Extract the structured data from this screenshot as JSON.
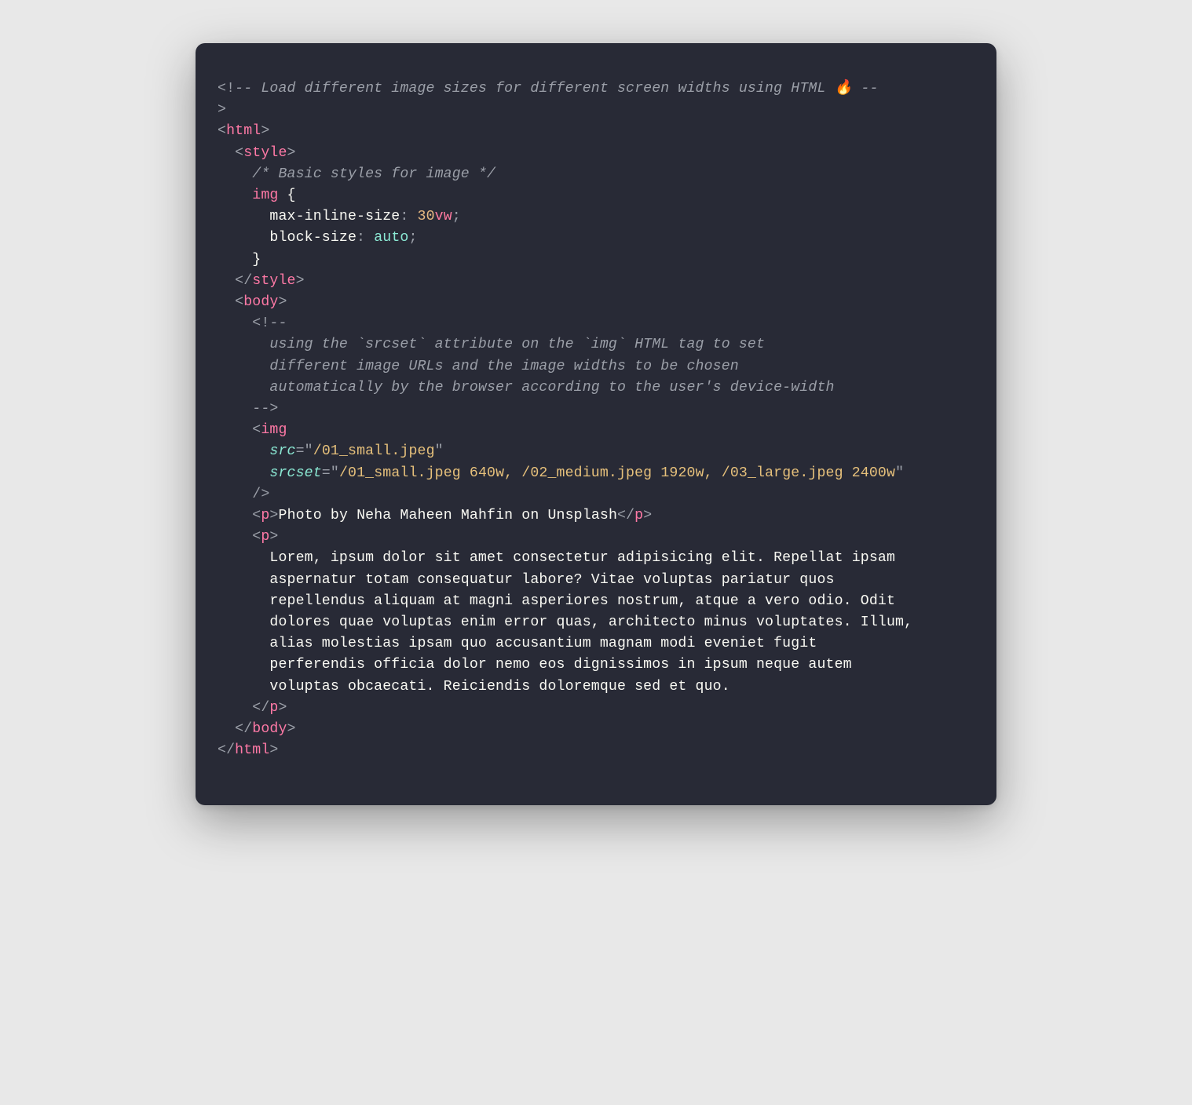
{
  "lines": [
    [
      {
        "cls": "pn",
        "t": "<!"
      },
      {
        "cls": "cm",
        "t": "-- Load different image sizes for different screen widths using HTML 🔥 --"
      }
    ],
    [
      {
        "cls": "pn",
        "t": ">"
      }
    ],
    [
      {
        "cls": "pn",
        "t": "<"
      },
      {
        "cls": "tg",
        "t": "html"
      },
      {
        "cls": "pn",
        "t": ">"
      }
    ],
    [
      {
        "cls": "txt",
        "t": "  "
      },
      {
        "cls": "pn",
        "t": "<"
      },
      {
        "cls": "tg",
        "t": "style"
      },
      {
        "cls": "pn",
        "t": ">"
      }
    ],
    [
      {
        "cls": "cm",
        "t": "    /* Basic styles for image */"
      }
    ],
    [
      {
        "cls": "txt",
        "t": "    "
      },
      {
        "cls": "sel",
        "t": "img"
      },
      {
        "cls": "txt",
        "t": " {"
      }
    ],
    [
      {
        "cls": "txt",
        "t": "      "
      },
      {
        "cls": "prop",
        "t": "max-inline-size"
      },
      {
        "cls": "pn",
        "t": ": "
      },
      {
        "cls": "num",
        "t": "30"
      },
      {
        "cls": "unit",
        "t": "vw"
      },
      {
        "cls": "pn",
        "t": ";"
      }
    ],
    [
      {
        "cls": "txt",
        "t": "      "
      },
      {
        "cls": "prop",
        "t": "block-size"
      },
      {
        "cls": "pn",
        "t": ": "
      },
      {
        "cls": "auto",
        "t": "auto"
      },
      {
        "cls": "pn",
        "t": ";"
      }
    ],
    [
      {
        "cls": "txt",
        "t": "    }"
      }
    ],
    [
      {
        "cls": "txt",
        "t": "  "
      },
      {
        "cls": "pn",
        "t": "</"
      },
      {
        "cls": "tg",
        "t": "style"
      },
      {
        "cls": "pn",
        "t": ">"
      }
    ],
    [
      {
        "cls": "txt",
        "t": "  "
      },
      {
        "cls": "pn",
        "t": "<"
      },
      {
        "cls": "tg",
        "t": "body"
      },
      {
        "cls": "pn",
        "t": ">"
      }
    ],
    [
      {
        "cls": "txt",
        "t": "    "
      },
      {
        "cls": "pn",
        "t": "<!"
      },
      {
        "cls": "cm",
        "t": "--"
      }
    ],
    [
      {
        "cls": "cm",
        "t": "      using the `srcset` attribute on the `img` HTML tag to set"
      }
    ],
    [
      {
        "cls": "cm",
        "t": "      different image URLs and the image widths to be chosen"
      }
    ],
    [
      {
        "cls": "cm",
        "t": "      automatically by the browser according to the user's device-width"
      }
    ],
    [
      {
        "cls": "txt",
        "t": "    "
      },
      {
        "cls": "cm",
        "t": "-->"
      }
    ],
    [
      {
        "cls": "txt",
        "t": "    "
      },
      {
        "cls": "pn",
        "t": "<"
      },
      {
        "cls": "tg",
        "t": "img"
      }
    ],
    [
      {
        "cls": "txt",
        "t": "      "
      },
      {
        "cls": "attr",
        "t": "src"
      },
      {
        "cls": "pn",
        "t": "="
      },
      {
        "cls": "pn",
        "t": "\""
      },
      {
        "cls": "str",
        "t": "/01_small.jpeg"
      },
      {
        "cls": "pn",
        "t": "\""
      }
    ],
    [
      {
        "cls": "txt",
        "t": "      "
      },
      {
        "cls": "attr",
        "t": "srcset"
      },
      {
        "cls": "pn",
        "t": "="
      },
      {
        "cls": "pn",
        "t": "\""
      },
      {
        "cls": "str",
        "t": "/01_small.jpeg 640w, /02_medium.jpeg 1920w, /03_large.jpeg 2400w"
      },
      {
        "cls": "pn",
        "t": "\""
      }
    ],
    [
      {
        "cls": "txt",
        "t": "    "
      },
      {
        "cls": "pn",
        "t": "/>"
      }
    ],
    [
      {
        "cls": "txt",
        "t": "    "
      },
      {
        "cls": "pn",
        "t": "<"
      },
      {
        "cls": "tg",
        "t": "p"
      },
      {
        "cls": "pn",
        "t": ">"
      },
      {
        "cls": "txt",
        "t": "Photo by Neha Maheen Mahfin on Unsplash"
      },
      {
        "cls": "pn",
        "t": "</"
      },
      {
        "cls": "tg",
        "t": "p"
      },
      {
        "cls": "pn",
        "t": ">"
      }
    ],
    [
      {
        "cls": "txt",
        "t": "    "
      },
      {
        "cls": "pn",
        "t": "<"
      },
      {
        "cls": "tg",
        "t": "p"
      },
      {
        "cls": "pn",
        "t": ">"
      }
    ],
    [
      {
        "cls": "txt",
        "t": "      Lorem, ipsum dolor sit amet consectetur adipisicing elit. Repellat ipsam"
      }
    ],
    [
      {
        "cls": "txt",
        "t": "      aspernatur totam consequatur labore? Vitae voluptas pariatur quos"
      }
    ],
    [
      {
        "cls": "txt",
        "t": "      repellendus aliquam at magni asperiores nostrum, atque a vero odio. Odit"
      }
    ],
    [
      {
        "cls": "txt",
        "t": "      dolores quae voluptas enim error quas, architecto minus voluptates. Illum,"
      }
    ],
    [
      {
        "cls": "txt",
        "t": "      alias molestias ipsam quo accusantium magnam modi eveniet fugit"
      }
    ],
    [
      {
        "cls": "txt",
        "t": "      perferendis officia dolor nemo eos dignissimos in ipsum neque autem"
      }
    ],
    [
      {
        "cls": "txt",
        "t": "      voluptas obcaecati. Reiciendis doloremque sed et quo."
      }
    ],
    [
      {
        "cls": "txt",
        "t": "    "
      },
      {
        "cls": "pn",
        "t": "</"
      },
      {
        "cls": "tg",
        "t": "p"
      },
      {
        "cls": "pn",
        "t": ">"
      }
    ],
    [
      {
        "cls": "txt",
        "t": "  "
      },
      {
        "cls": "pn",
        "t": "</"
      },
      {
        "cls": "tg",
        "t": "body"
      },
      {
        "cls": "pn",
        "t": ">"
      }
    ],
    [
      {
        "cls": "pn",
        "t": "</"
      },
      {
        "cls": "tg",
        "t": "html"
      },
      {
        "cls": "pn",
        "t": ">"
      }
    ]
  ]
}
